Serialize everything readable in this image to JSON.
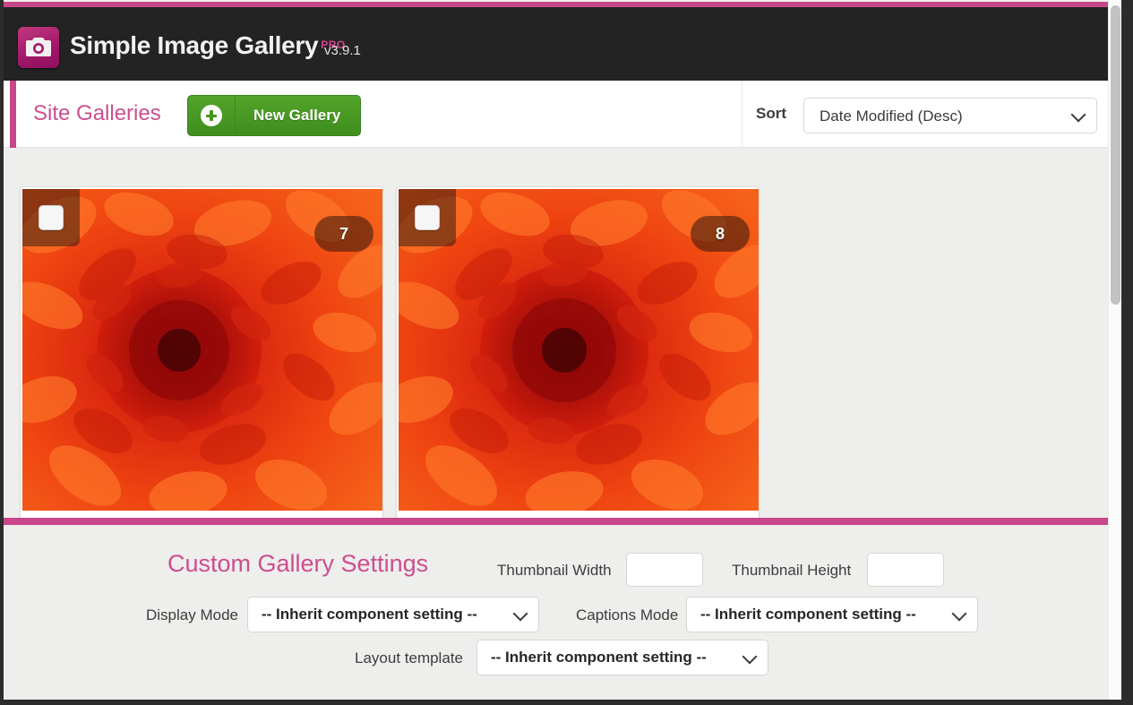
{
  "app": {
    "name": "Simple Image Gallery",
    "edition": "PRO",
    "version": "v3.9.1",
    "logo_icon": "camera-icon"
  },
  "colors": {
    "accent_pink": "#c8468a",
    "title_pink": "#cc4e8f",
    "button_green": "#489b23",
    "header_dark": "#232323",
    "page_background": "#eeeeec"
  },
  "toolbar": {
    "page_title": "Site Galleries",
    "new_gallery_label": "New Gallery",
    "new_gallery_icon": "plus-circle-icon",
    "sort_label": "Sort",
    "sort_value": "Date Modified (Desc)",
    "sort_icon": "chevron-down-icon"
  },
  "galleries": [
    {
      "image_count": "7",
      "checkbox_checked": false,
      "thumbnail_alt": "orange chrysanthemum flower"
    },
    {
      "image_count": "8",
      "checkbox_checked": false,
      "thumbnail_alt": "orange chrysanthemum flower"
    }
  ],
  "settings": {
    "title": "Custom Gallery Settings",
    "thumbnail_width": {
      "label": "Thumbnail Width",
      "value": ""
    },
    "thumbnail_height": {
      "label": "Thumbnail Height",
      "value": ""
    },
    "display_mode": {
      "label": "Display Mode",
      "value": "-- Inherit component setting --",
      "icon": "chevron-down-icon"
    },
    "captions_mode": {
      "label": "Captions Mode",
      "value": "-- Inherit component setting --",
      "icon": "chevron-down-icon"
    },
    "layout_template": {
      "label": "Layout template",
      "value": "-- Inherit component setting --",
      "icon": "chevron-down-icon"
    }
  }
}
